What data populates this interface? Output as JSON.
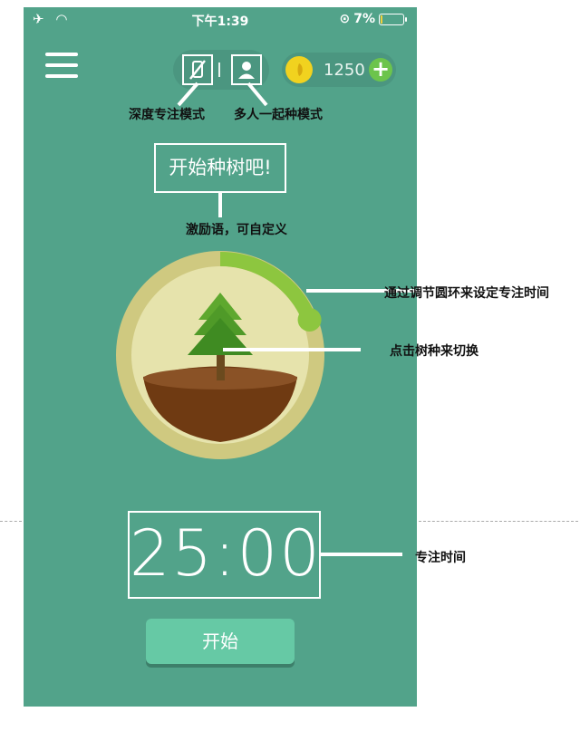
{
  "status_bar": {
    "time": "下午1:39",
    "battery": "7%",
    "battery_level": 0.07
  },
  "toolbar": {
    "menu_icon": "hamburger-icon",
    "deep_focus_icon": "no-phone-icon",
    "multi_plant_icon": "person-icon",
    "coin_icon": "coin-icon",
    "coins": "1250",
    "add_icon": "plus-icon"
  },
  "main": {
    "slogan": "开始种树吧!",
    "timer": "25:00",
    "start_button": "开始",
    "timer_progress": 0.19
  },
  "annotations": {
    "deep_focus_mode": "深度专注模式",
    "multi_plant_mode": "多人一起种模式",
    "slogan_note": "激励语，可自定义",
    "ring_note": "通过调节圆环来设定专注时间",
    "tree_note": "点击树种来切换",
    "timer_note": "专注时间"
  },
  "colors": {
    "background": "#52a38a",
    "ring": "#cfc980",
    "ring_progress": "#8dc63f",
    "button": "#66c9a5"
  }
}
